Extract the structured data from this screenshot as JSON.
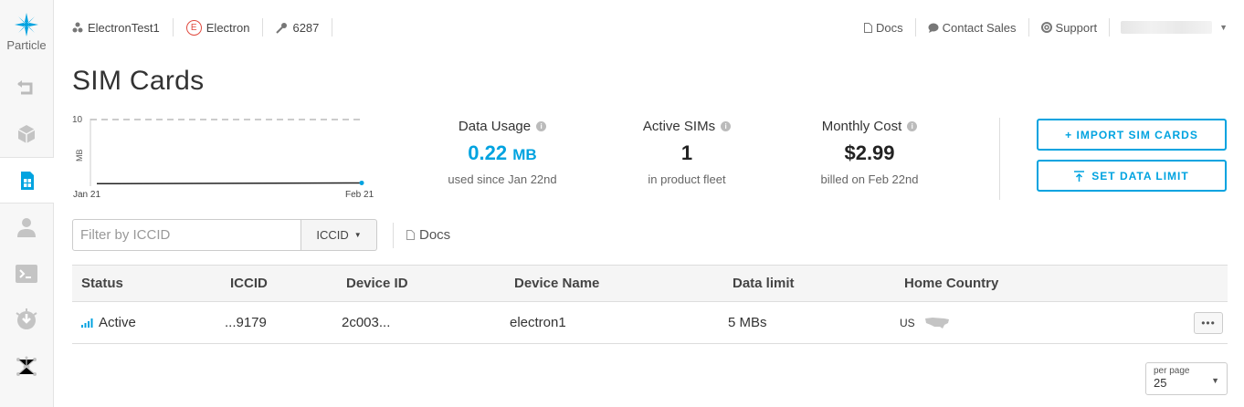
{
  "sidebar": {
    "logo_text": "Particle",
    "items": [
      "back-icon",
      "product-icon",
      "sim-card-icon",
      "user-icon",
      "console-icon",
      "integrations-icon",
      "network-icon"
    ]
  },
  "topbar": {
    "product_name": "ElectronTest1",
    "platform": "Electron",
    "platform_badge": "E",
    "product_id": "6287",
    "links": {
      "docs": "Docs",
      "contact_sales": "Contact Sales",
      "support": "Support"
    }
  },
  "page_title": "SIM Cards",
  "chart_data": {
    "type": "line",
    "x_labels": [
      "Jan 21",
      "Feb 21"
    ],
    "ylabel": "MB",
    "ymax_label": "10",
    "ylim": [
      0,
      10
    ],
    "limit_line": 10,
    "series": [
      {
        "values": [
          0.1,
          0.22
        ]
      }
    ]
  },
  "stats": {
    "data_usage": {
      "label": "Data Usage",
      "value": "0.22",
      "unit": "MB",
      "sub": "used since Jan 22nd"
    },
    "active_sims": {
      "label": "Active SIMs",
      "value": "1",
      "sub": "in product fleet"
    },
    "monthly_cost": {
      "label": "Monthly Cost",
      "value": "$2.99",
      "sub": "billed on Feb 22nd"
    }
  },
  "buttons": {
    "import": "+ IMPORT SIM CARDS",
    "data_limit": "SET DATA LIMIT"
  },
  "filter": {
    "placeholder": "Filter by ICCID",
    "select_value": "ICCID",
    "docs": "Docs"
  },
  "table": {
    "headers": [
      "Status",
      "ICCID",
      "Device ID",
      "Device Name",
      "Data limit",
      "Home Country"
    ],
    "rows": [
      {
        "status": "Active",
        "iccid": "...9179",
        "device_id": "2c003...",
        "device_name": "electron1",
        "data_limit": "5 MBs",
        "country": "US",
        "more": "•••"
      }
    ]
  },
  "pagination": {
    "label": "per page",
    "value": "25"
  },
  "colors": {
    "accent": "#00a3e0",
    "electron_red": "#e04a3f"
  }
}
